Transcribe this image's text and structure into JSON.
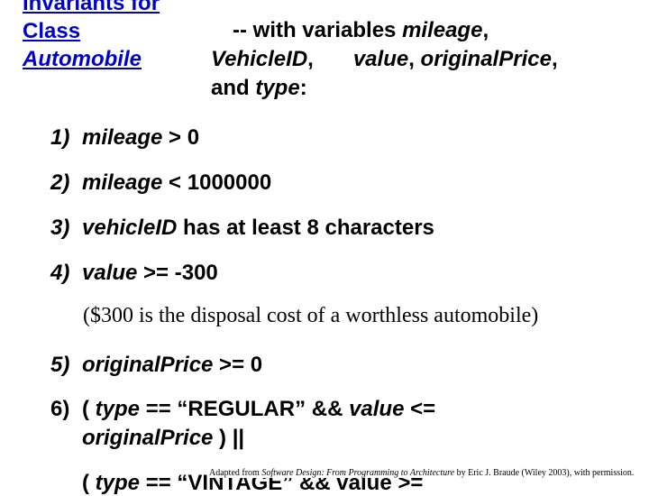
{
  "title": {
    "line1": "Invariants for",
    "line2": "Class",
    "line3": "Automobile"
  },
  "intro": {
    "prefix": "-- with variables ",
    "var1": "mileage",
    "comma1": ",",
    "var2": "VehicleID",
    "comma2": ",",
    "var3": "value",
    "comma3": ", ",
    "var4": "originalPrice",
    "comma4": ",",
    "and": "and ",
    "var5": "type",
    "colon": ":"
  },
  "invariants": [
    {
      "num": "1)",
      "var": "mileage",
      "rest": " >  0"
    },
    {
      "num": "2)",
      "var": "mileage",
      "rest": " < 1000000"
    },
    {
      "num": "3)",
      "var": "vehicleID",
      "rest": " has at least 8 characters"
    },
    {
      "num": "4)",
      "var": "value",
      "rest": " >= -300"
    },
    {
      "num": "5)",
      "var": "originalPrice",
      "rest": " >= 0"
    }
  ],
  "note": "($300 is the disposal cost of a worthless automobile)",
  "item6": {
    "num": "6)",
    "open": "( ",
    "var_type": "type",
    "eq": " == “REGULAR” && ",
    "var_value": "value",
    "le": " <=",
    "var_orig": "originalPrice",
    "close": " ) ||",
    "line3_open": "( ",
    "line3_var": "type",
    "line3_rest": " == “VINTAGE” && value >="
  },
  "credit": {
    "prefix": "Adapted from ",
    "book": "Software Design: From Programming to Architecture",
    "suffix": " by Eric J. Braude (Wiley 2003), with permission."
  }
}
